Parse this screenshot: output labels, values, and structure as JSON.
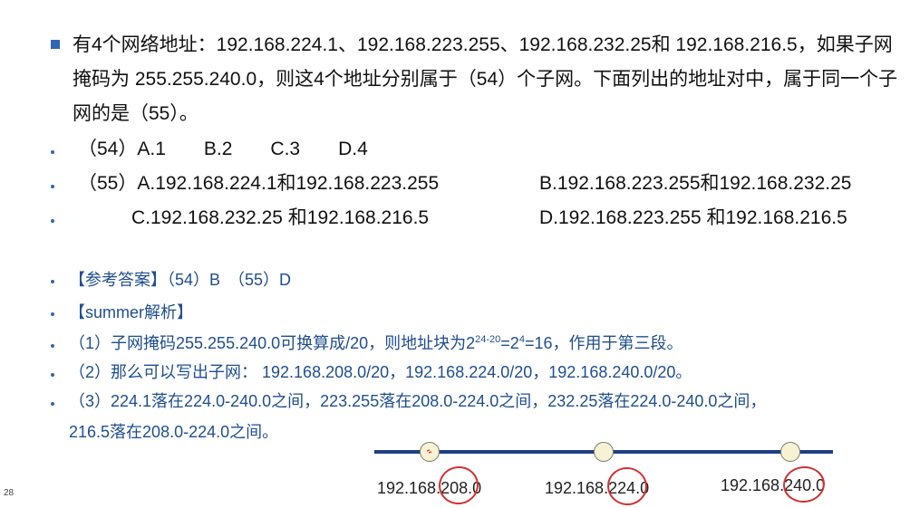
{
  "page_number": "28",
  "question": {
    "lines": [
      "有4个网络地址：192.168.224.1、192.168.223.255、192.168.232.25和 192.168.216.5，如果子网",
      "掩码为 255.255.240.0，则这4个地址分别属于（54）个子网。下面列出的地址对中，属于同一个子",
      "网的是（55）。"
    ]
  },
  "options": {
    "q54": "（54）A.1　　B.2　　C.3　　D.4",
    "q55_a": "（55）A.192.168.224.1和192.168.223.255",
    "q55_b": "B.192.168.223.255和192.168.232.25",
    "q55_c": "C.192.168.232.25 和192.168.216.5",
    "q55_d": "D.192.168.223.255 和192.168.216.5"
  },
  "answer": {
    "reference": "【参考答案】（54）B　（55）D",
    "analysis_title": "【summer解析】",
    "step1_prefix": "（1）子网掩码255.255.240.0可换算成/20，则地址块为2",
    "step1_exp1": "24-20",
    "step1_mid": "=2",
    "step1_exp2": "4",
    "step1_suffix": "=16，作用于第三段。",
    "step2": "（2）那么可以写出子网： 192.168.208.0/20，192.168.224.0/20，192.168.240.0/20。",
    "step3_line1": "（3）224.1落在224.0-240.0之间，223.255落在208.0-224.0之间，232.25落在224.0-240.0之间，",
    "step3_line2": "216.5落在208.0-224.0之间。"
  },
  "number_line": {
    "labels": [
      "192.168.208.0",
      "192.168.224.0",
      "192.168.240.0"
    ],
    "line_color": "#1f3f82",
    "mark_color": "#d23030"
  }
}
